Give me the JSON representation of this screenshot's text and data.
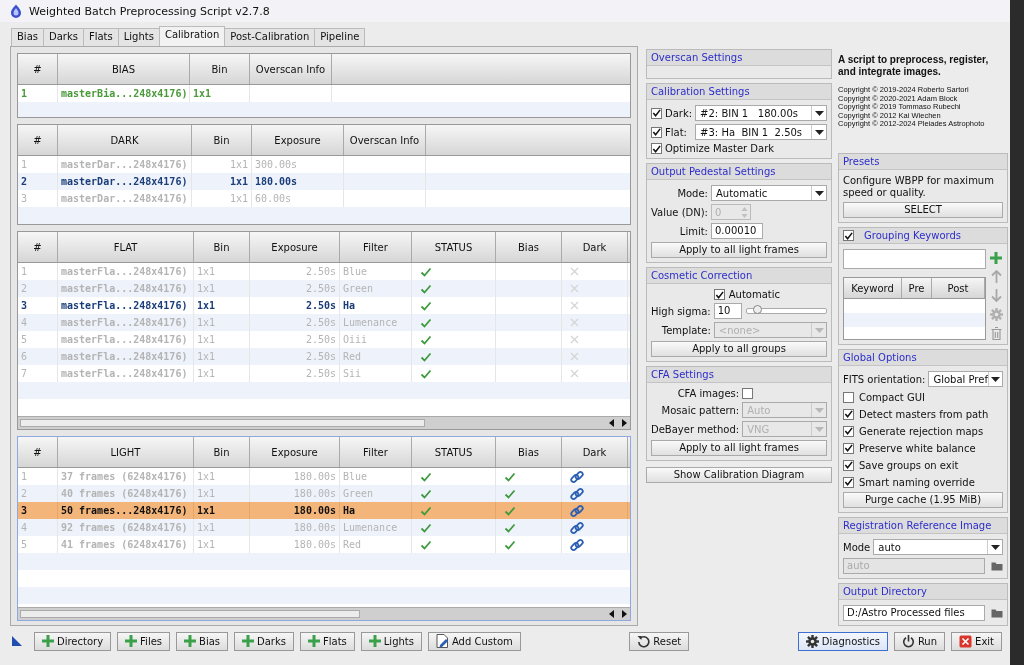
{
  "window": {
    "title": "Weighted Batch Preprocessing Script v2.7.8"
  },
  "tabs": [
    {
      "label": "Bias",
      "selected": false
    },
    {
      "label": "Darks",
      "selected": false
    },
    {
      "label": "Flats",
      "selected": false
    },
    {
      "label": "Lights",
      "selected": false
    },
    {
      "label": "Calibration",
      "selected": true
    },
    {
      "label": "Post-Calibration",
      "selected": false
    },
    {
      "label": "Pipeline",
      "selected": false
    }
  ],
  "tables": [
    {
      "kind": "bias",
      "columns": [
        "#",
        "BIAS",
        "Bin",
        "Overscan Info"
      ],
      "rows": [
        {
          "kind": "matched",
          "cells": [
            "1",
            "masterBia...248x4176)",
            "1x1"
          ]
        }
      ]
    },
    {
      "kind": "dark",
      "columns": [
        "#",
        "DARK",
        "Bin",
        "Exposure",
        "Overscan Info"
      ],
      "rows": [
        {
          "kind": "inactive",
          "cells": [
            "1",
            "masterDar...248x4176)",
            "1x1",
            "300.00s"
          ]
        },
        {
          "kind": "selected",
          "cells": [
            "2",
            "masterDar...248x4176)",
            "1x1",
            "180.00s"
          ]
        },
        {
          "kind": "inactive",
          "cells": [
            "3",
            "masterDar...248x4176)",
            "1x1",
            "60.00s"
          ]
        }
      ]
    },
    {
      "kind": "flat",
      "columns": [
        "#",
        "FLAT",
        "Bin",
        "Exposure",
        "Filter",
        "STATUS",
        "Bias",
        "Dark"
      ],
      "rows": [
        {
          "kind": "inactive",
          "cells": [
            "1",
            "masterFla...248x4176)",
            "1x1",
            "2.50s",
            "Blue"
          ],
          "marks": [
            {
              "kind": "check"
            },
            {
              "kind": "none"
            },
            {
              "kind": "cross"
            }
          ]
        },
        {
          "kind": "inactive",
          "cells": [
            "2",
            "masterFla...248x4176)",
            "1x1",
            "2.50s",
            "Green"
          ],
          "marks": [
            {
              "kind": "check"
            },
            {
              "kind": "none"
            },
            {
              "kind": "cross"
            }
          ]
        },
        {
          "kind": "selected",
          "cells": [
            "3",
            "masterFla...248x4176)",
            "1x1",
            "2.50s",
            "Ha"
          ],
          "marks": [
            {
              "kind": "check"
            },
            {
              "kind": "none"
            },
            {
              "kind": "cross"
            }
          ]
        },
        {
          "kind": "inactive",
          "cells": [
            "4",
            "masterFla...248x4176)",
            "1x1",
            "2.50s",
            "Lumenance"
          ],
          "marks": [
            {
              "kind": "check"
            },
            {
              "kind": "none"
            },
            {
              "kind": "cross"
            }
          ]
        },
        {
          "kind": "inactive",
          "cells": [
            "5",
            "masterFla...248x4176)",
            "1x1",
            "2.50s",
            "Oiii"
          ],
          "marks": [
            {
              "kind": "check"
            },
            {
              "kind": "none"
            },
            {
              "kind": "cross"
            }
          ]
        },
        {
          "kind": "inactive",
          "cells": [
            "6",
            "masterFla...248x4176)",
            "1x1",
            "2.50s",
            "Red"
          ],
          "marks": [
            {
              "kind": "check"
            },
            {
              "kind": "none"
            },
            {
              "kind": "cross"
            }
          ]
        },
        {
          "kind": "inactive",
          "cells": [
            "7",
            "masterFla...248x4176)",
            "1x1",
            "2.50s",
            "Sii"
          ],
          "marks": [
            {
              "kind": "check"
            },
            {
              "kind": "none"
            },
            {
              "kind": "cross"
            }
          ]
        }
      ]
    },
    {
      "kind": "light",
      "columns": [
        "#",
        "LIGHT",
        "Bin",
        "Exposure",
        "Filter",
        "STATUS",
        "Bias",
        "Dark"
      ],
      "rows": [
        {
          "kind": "inactive",
          "cells": [
            "1",
            "37 frames (6248x4176)",
            "1x1",
            "180.00s",
            "Blue"
          ],
          "marks": [
            {
              "kind": "check"
            },
            {
              "kind": "check"
            },
            {
              "kind": "link"
            }
          ]
        },
        {
          "kind": "inactive",
          "cells": [
            "2",
            "40 frames (6248x4176)",
            "1x1",
            "180.00s",
            "Green"
          ],
          "marks": [
            {
              "kind": "check"
            },
            {
              "kind": "check"
            },
            {
              "kind": "link"
            }
          ]
        },
        {
          "kind": "current",
          "cells": [
            "3",
            "50 frames...248x4176)",
            "1x1",
            "180.00s",
            "Ha"
          ],
          "marks": [
            {
              "kind": "check"
            },
            {
              "kind": "check"
            },
            {
              "kind": "link"
            }
          ]
        },
        {
          "kind": "inactive",
          "cells": [
            "4",
            "92 frames (6248x4176)",
            "1x1",
            "180.00s",
            "Lumenance"
          ],
          "marks": [
            {
              "kind": "check"
            },
            {
              "kind": "check"
            },
            {
              "kind": "link"
            }
          ]
        },
        {
          "kind": "inactive",
          "cells": [
            "5",
            "41 frames (6248x4176)",
            "1x1",
            "180.00s",
            "Red"
          ],
          "marks": [
            {
              "kind": "check"
            },
            {
              "kind": "check"
            },
            {
              "kind": "link"
            }
          ]
        }
      ]
    }
  ],
  "sections": [
    {
      "title": "Overscan Settings"
    },
    {
      "title": "Calibration Settings",
      "items": [
        {
          "kind": "check-select",
          "label": "Dark:",
          "checked": true,
          "value": "#2: BIN 1   180.00s"
        },
        {
          "kind": "check-select",
          "label": "Flat:",
          "checked": true,
          "value": "#3: Ha  BIN 1  2.50s"
        },
        {
          "kind": "checkbox",
          "label": "Optimize Master Dark",
          "checked": true
        }
      ]
    },
    {
      "title": "Output Pedestal Settings",
      "items": [
        {
          "kind": "select",
          "label": "Mode:",
          "value": "Automatic",
          "disabled": false
        },
        {
          "kind": "spinner",
          "label": "Value (DN):",
          "value": "0",
          "disabled": true
        },
        {
          "kind": "input",
          "label": "Limit:",
          "value": "0.00010"
        },
        {
          "kind": "button",
          "label": "Apply to all light frames"
        }
      ]
    },
    {
      "title": "Cosmetic Correction",
      "items": [
        {
          "kind": "field-checkbox",
          "label": "Automatic",
          "checked": true
        },
        {
          "kind": "slider",
          "label": "High sigma:",
          "value": "10",
          "level": 0.1
        },
        {
          "kind": "select",
          "label": "Template:",
          "value": "<none>",
          "disabled": true
        },
        {
          "kind": "button",
          "label": "Apply to all groups"
        }
      ]
    },
    {
      "title": "CFA Settings",
      "items": [
        {
          "kind": "labeled-checkbox",
          "label": "CFA images:",
          "checked": false
        },
        {
          "kind": "select",
          "label": "Mosaic pattern:",
          "value": "Auto",
          "disabled": true
        },
        {
          "kind": "select",
          "label": "DeBayer method:",
          "value": "VNG",
          "disabled": true
        },
        {
          "kind": "button",
          "label": "Apply to all light frames"
        }
      ]
    }
  ],
  "diagram_button": "Show Calibration Diagram",
  "about": {
    "description": "A script to preprocess, register, and integrate images.",
    "copyrights": [
      "Copyright © 2019-2024 Roberto Sartori",
      "Copyright © 2020-2021 Adam Block",
      "Copyright © 2019 Tommaso Rubechi",
      "Copyright © 2012 Kai Wiechen",
      "Copyright © 2012-2024 Pleiades Astrophoto"
    ]
  },
  "presets": {
    "title": "Presets",
    "text": "Configure WBPP for maximum speed or quality.",
    "button": "SELECT"
  },
  "grouping": {
    "title": "Grouping Keywords",
    "checked": true,
    "columns": [
      "Keyword",
      "Pre",
      "Post"
    ]
  },
  "global_options": {
    "title": "Global Options",
    "fits_label": "FITS orientation:",
    "fits_value": "Global Pref",
    "options": [
      {
        "label": "Compact GUI",
        "checked": false
      },
      {
        "label": "Detect masters from path",
        "checked": true
      },
      {
        "label": "Generate rejection maps",
        "checked": true
      },
      {
        "label": "Preserve white balance",
        "checked": true
      },
      {
        "label": "Save groups on exit",
        "checked": true
      },
      {
        "label": "Smart naming override",
        "checked": true
      }
    ],
    "button": "Purge cache (1.95 MiB)"
  },
  "registration": {
    "title": "Registration Reference Image",
    "mode_label": "Mode",
    "mode_value": "auto",
    "path": "auto"
  },
  "output": {
    "title": "Output Directory",
    "path": "D:/Astro Processed files"
  },
  "left_buttons": [
    {
      "kind": "add",
      "label": "Directory"
    },
    {
      "kind": "add",
      "label": "Files"
    },
    {
      "kind": "add",
      "label": "Bias"
    },
    {
      "kind": "add",
      "label": "Darks"
    },
    {
      "kind": "add",
      "label": "Flats"
    },
    {
      "kind": "add",
      "label": "Lights"
    },
    {
      "kind": "custom",
      "label": "Add Custom"
    }
  ],
  "center_buttons": [
    {
      "kind": "reset",
      "label": "Reset"
    }
  ],
  "right_buttons": [
    {
      "kind": "gear",
      "label": "Diagnostics",
      "selected": true
    },
    {
      "kind": "power",
      "label": "Run",
      "selected": false
    },
    {
      "kind": "exit",
      "label": "Exit",
      "selected": false
    }
  ]
}
